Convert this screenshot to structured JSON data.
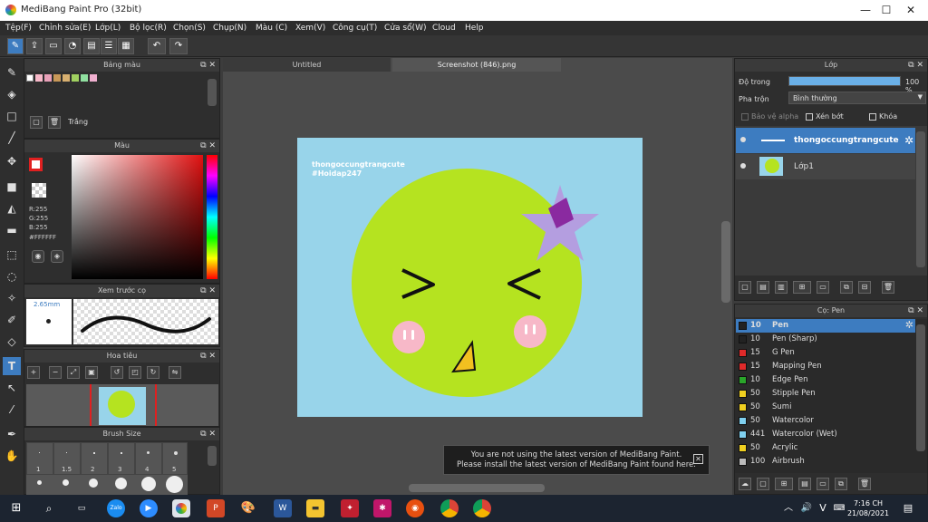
{
  "window": {
    "title": "MediBang Paint Pro (32bit)",
    "minimize": "—",
    "maximize": "☐",
    "close": "✕"
  },
  "menu": [
    "Tệp(F)",
    "Chỉnh sửa(E)",
    "Lớp(L)",
    "Bộ lọc(R)",
    "Chọn(S)",
    "Chụp(N)",
    "Màu (C)",
    "Xem(V)",
    "Công cụ(T)",
    "Cửa sổ(W)",
    "Cloud",
    "Help"
  ],
  "panels": {
    "palette": {
      "title": "Bảng màu",
      "swatch_label": "Trắng"
    },
    "color": {
      "title": "Màu",
      "r": "R:255",
      "g": "G:255",
      "b": "B:255",
      "hex": "#FFFFFF"
    },
    "preview": {
      "title": "Xem trước cọ",
      "size": "2.65mm"
    },
    "navigator": {
      "title": "Hoa tiêu"
    },
    "brush_size": {
      "title": "Brush Size",
      "sizes": [
        "1",
        "1.5",
        "2",
        "3",
        "4",
        "5"
      ]
    }
  },
  "tabs": [
    "Untitled",
    "Screenshot (846).png"
  ],
  "canvas": {
    "watermark_line1": "thongoccungtrangcute",
    "watermark_line2": "#Hoidap247"
  },
  "notice": {
    "line1": "You are not using the latest version of MediBang Paint.",
    "line2": "Please install the latest version of MediBang Paint found here."
  },
  "layers_panel": {
    "title": "Lớp",
    "opacity_label": "Độ trong",
    "opacity_value": "100 %",
    "opacity_fraction": 1.0,
    "blend_label": "Pha trộn",
    "blend_value": "Bình thường",
    "protect_alpha": "Bảo vệ alpha",
    "clipping": "Xén bớt",
    "lock": "Khóa",
    "layers": [
      {
        "name": "thongoccungtrangcute",
        "selected": true
      },
      {
        "name": "Lớp1",
        "selected": false
      }
    ]
  },
  "brush_panel": {
    "title": "Cọ: Pen",
    "brushes": [
      {
        "size": "10",
        "name": "Pen",
        "color": "#222222",
        "selected": true
      },
      {
        "size": "10",
        "name": "Pen (Sharp)",
        "color": "#222222"
      },
      {
        "size": "15",
        "name": "G Pen",
        "color": "#e02a2a"
      },
      {
        "size": "15",
        "name": "Mapping Pen",
        "color": "#e02a2a"
      },
      {
        "size": "10",
        "name": "Edge Pen",
        "color": "#2aa52a"
      },
      {
        "size": "50",
        "name": "Stipple Pen",
        "color": "#f0d020"
      },
      {
        "size": "50",
        "name": "Sumi",
        "color": "#f0d020"
      },
      {
        "size": "50",
        "name": "Watercolor",
        "color": "#7fd0ef"
      },
      {
        "size": "441",
        "name": "Watercolor (Wet)",
        "color": "#7fd0ef"
      },
      {
        "size": "50",
        "name": "Acrylic",
        "color": "#f0d020"
      },
      {
        "size": "100",
        "name": "Airbrush",
        "color": "#bbbbbb"
      }
    ]
  },
  "taskbar": {
    "time": "7:16 CH",
    "date": "21/08/2021",
    "lang": "V"
  },
  "colors": {
    "accent": "#3d7cc0",
    "canvas_bg": "#98d4ea",
    "face": "#b5e320",
    "star": "#b49ee0",
    "cheek": "#f7b8c8"
  }
}
